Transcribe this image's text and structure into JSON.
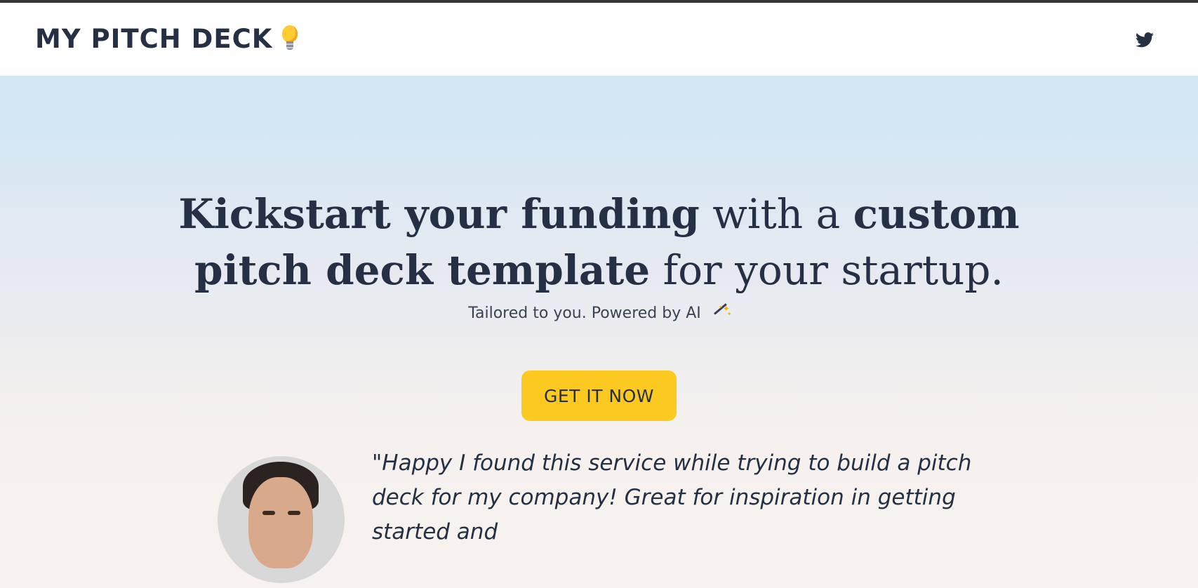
{
  "header": {
    "brand": "MY PITCH DECK",
    "brand_icon": "lightbulb-icon",
    "social_icon": "twitter-icon"
  },
  "hero": {
    "headline": {
      "part1": "Kickstart your funding",
      "part2": " with a ",
      "part3": "custom pitch deck template",
      "part4": " for your startup."
    },
    "subtitle": "Tailored to you. Powered by AI",
    "subtitle_icon": "magic-wand-icon",
    "cta_label": "GET IT NOW"
  },
  "testimonial": {
    "quote": "\"Happy I found this service while trying to build a pitch deck for my company! Great for inspiration in getting started and"
  },
  "colors": {
    "text": "#253045",
    "accent": "#fcc920",
    "hero_top": "#d3e7f4",
    "hero_bottom": "#f7f2ef"
  }
}
